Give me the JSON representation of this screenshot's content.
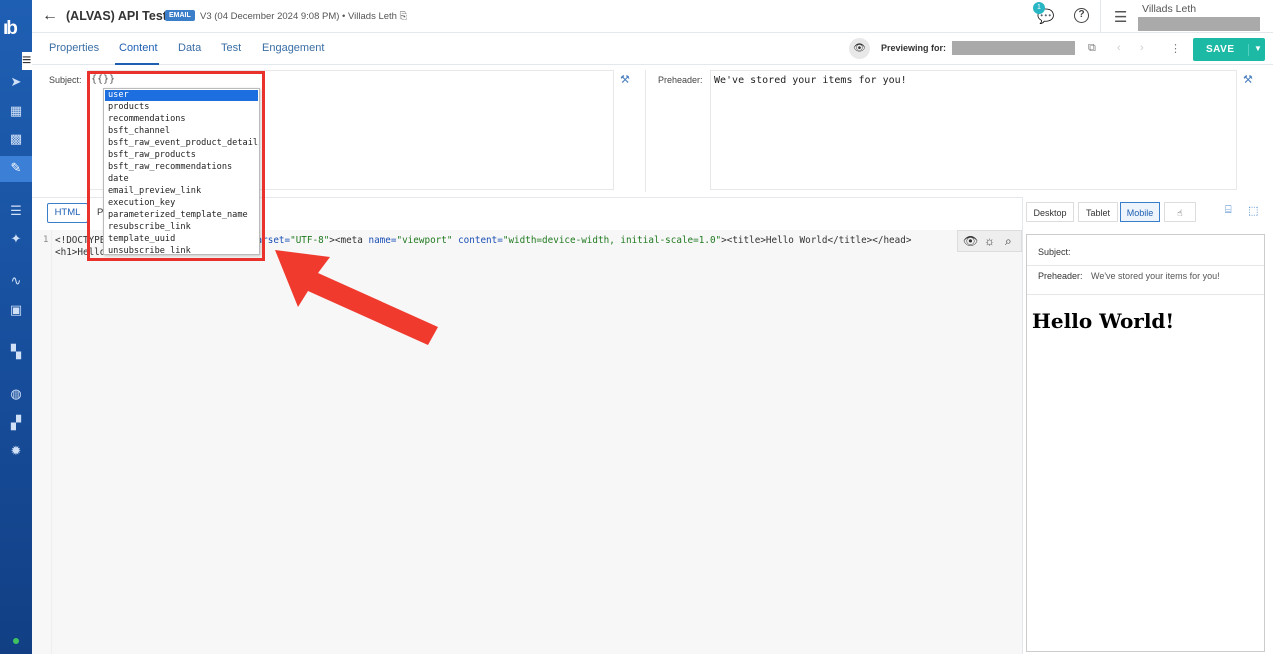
{
  "header": {
    "title": "(ALVAS) API Test",
    "badge": "EMAIL",
    "version": "V3 (04 December 2024 9:08 PM)",
    "author": "Villads Leth",
    "notification_count": "1",
    "user_name": "Villads Leth"
  },
  "tabs": [
    "Properties",
    "Content",
    "Data",
    "Test",
    "Engagement"
  ],
  "active_tab": "Content",
  "preview": {
    "label": "Previewing for:",
    "save_label": "SAVE"
  },
  "subject": {
    "label": "Subject:",
    "value": "{{}}"
  },
  "preheader": {
    "label": "Preheader:",
    "value": "We've stored your items for you!"
  },
  "editor": {
    "tab_html": "HTML",
    "tab_p": "P",
    "line_number": "1",
    "line1_a": "<!DOCTYPE",
    "line1_meta": "meta ",
    "line1_charset": "charset=",
    "line1_utf": "\"UTF-8\"",
    "line1_b": "><meta ",
    "line1_name": "name=",
    "line1_viewport": "\"viewport\"",
    "line1_content": " content=",
    "line1_cval": "\"width=device-width, initial-scale=1.0\"",
    "line1_c": "><title>Hello World</title></head>",
    "line2": "<h1>Hello"
  },
  "autocomplete": {
    "items": [
      "user",
      "products",
      "recommendations",
      "bsft_channel",
      "bsft_raw_event_product_details",
      "bsft_raw_products",
      "bsft_raw_recommendations",
      "date",
      "email_preview_link",
      "execution_key",
      "parameterized_template_name",
      "resubscribe_link",
      "template_uuid",
      "unsubscribe_link"
    ],
    "selected": "user"
  },
  "preview_panel": {
    "tabs": [
      "Desktop",
      "Tablet",
      "Mobile"
    ],
    "active": "Mobile",
    "subject_label": "Subject:",
    "preheader_label": "Preheader:",
    "preheader_text": "We've stored your items for you!",
    "heading": "Hello World!"
  },
  "colors": {
    "rail": "#1f5fb3",
    "accent": "#1cb9a5",
    "highlight": "#e8322b"
  }
}
